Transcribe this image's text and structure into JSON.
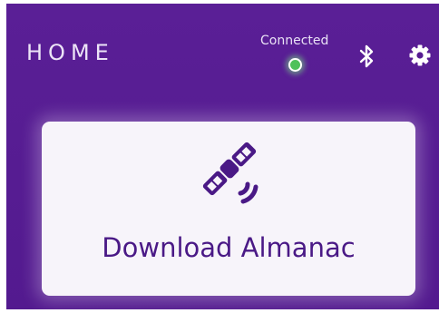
{
  "header": {
    "title": "HOME"
  },
  "status": {
    "label": "Connected",
    "indicator_color": "#4fc15a"
  },
  "icons": {
    "bluetooth": "bluetooth-icon",
    "settings": "gear-icon",
    "satellite": "satellite-icon"
  },
  "card": {
    "label": "Download Almanac"
  },
  "colors": {
    "background": "#561c92",
    "card": "#f7f4fa",
    "accent": "#4a1986"
  }
}
